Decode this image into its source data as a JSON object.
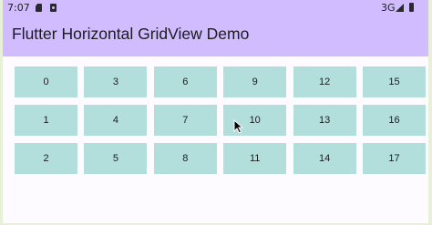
{
  "status_bar": {
    "time": "7:07",
    "network": "3G",
    "icons": [
      "sd-card-icon",
      "photo-icon",
      "signal-icon",
      "battery-icon"
    ]
  },
  "app_bar": {
    "title": "Flutter Horizontal GridView Demo"
  },
  "grid": {
    "scroll_direction": "horizontal",
    "rows": 3,
    "items": [
      "0",
      "1",
      "2",
      "3",
      "4",
      "5",
      "6",
      "7",
      "8",
      "9",
      "10",
      "11",
      "12",
      "13",
      "14",
      "15",
      "16",
      "17"
    ]
  },
  "colors": {
    "app_bar": "#d0bcfe",
    "tile": "#b2dfdb",
    "background": "#fdfbff",
    "frame": "#e9f0d8"
  }
}
